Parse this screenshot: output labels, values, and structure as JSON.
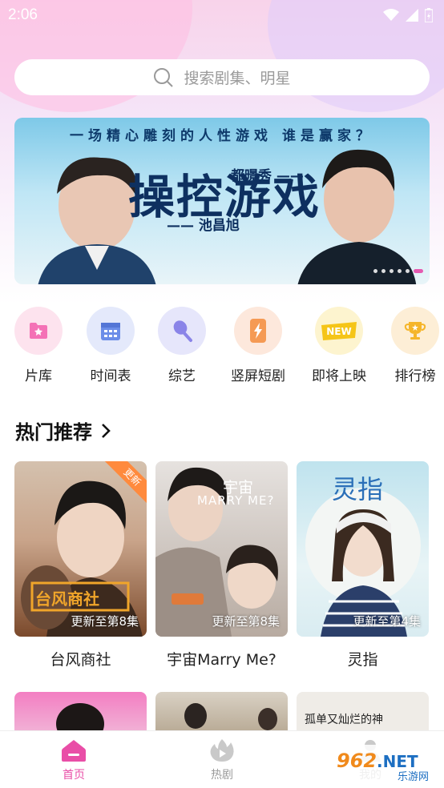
{
  "status_bar": {
    "time": "2:06"
  },
  "search": {
    "placeholder": "搜索剧集、明星"
  },
  "banner": {
    "tagline": "一场精心雕刻的人性游戏 谁是赢家？",
    "title": "操控游戏",
    "actor_right": "都暻秀",
    "actor_left": "池昌旭",
    "dots_count": 6,
    "active_dot": 5
  },
  "categories": [
    {
      "label": "片库",
      "icon": "film-library-icon",
      "bg": "#fde3ee",
      "color": "#f472b6"
    },
    {
      "label": "时间表",
      "icon": "calendar-icon",
      "bg": "#e4e9fb",
      "color": "#6b8de8"
    },
    {
      "label": "综艺",
      "icon": "variety-icon",
      "bg": "#e6e6fb",
      "color": "#8a84e8"
    },
    {
      "label": "竖屏短剧",
      "icon": "short-drama-icon",
      "bg": "#fde8dc",
      "color": "#f59a54"
    },
    {
      "label": "即将上映",
      "icon": "new-icon",
      "bg": "#fdf4cf",
      "color": "#f5c518"
    },
    {
      "label": "排行榜",
      "icon": "trophy-icon",
      "bg": "#fdeed6",
      "color": "#f5b52a"
    }
  ],
  "section": {
    "title": "热门推荐"
  },
  "cards": [
    {
      "title": "台风商社",
      "update": "更新至第8集",
      "badge": "更新",
      "logo": "台风商社"
    },
    {
      "title": "宇宙Marry Me?",
      "update": "更新至第8集",
      "overlay_title": "宇宙",
      "overlay_sub": "MARRY ME?"
    },
    {
      "title": "灵指",
      "update": "更新至第4集",
      "overlay_title": "灵指"
    }
  ],
  "next_row_text": "孤单又灿烂的神",
  "tabs": [
    {
      "label": "首页",
      "active": true,
      "icon": "home-icon"
    },
    {
      "label": "热剧",
      "active": false,
      "icon": "hot-drama-icon"
    },
    {
      "label": "我的",
      "active": false,
      "icon": "profile-icon"
    }
  ],
  "watermark": {
    "text": "962.NET",
    "sub": "乐游网"
  },
  "colors": {
    "accent": "#e94ea7",
    "inactive": "#9a9a9a"
  }
}
